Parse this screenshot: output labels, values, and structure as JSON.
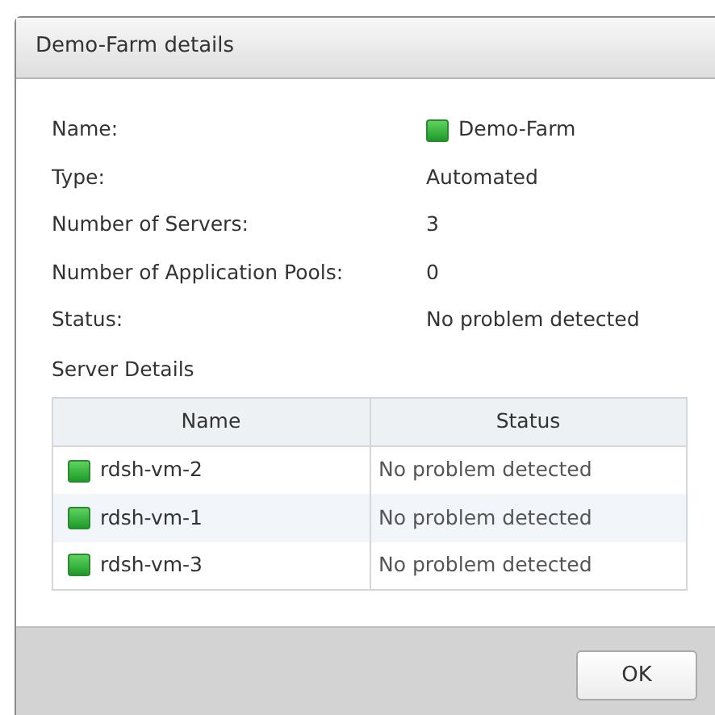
{
  "window": {
    "title": "Demo-Farm details"
  },
  "fields": [
    {
      "label": "Name:",
      "value": "Demo-Farm",
      "kind": "status"
    },
    {
      "label": "Type:",
      "value": "Automated",
      "kind": "text"
    },
    {
      "label": "Number of Servers:",
      "value": "3",
      "kind": "text"
    },
    {
      "label": "Number of Application Pools:",
      "value": "0",
      "kind": "text"
    },
    {
      "label": "Status:",
      "value": "No problem detected",
      "kind": "text"
    }
  ],
  "server_details": {
    "title": "Server Details",
    "columns": [
      "Name",
      "Status"
    ],
    "rows": [
      {
        "name": "rdsh-vm-2",
        "status": "No problem detected"
      },
      {
        "name": "rdsh-vm-1",
        "status": "No problem detected"
      },
      {
        "name": "rdsh-vm-3",
        "status": "No problem detected"
      }
    ]
  },
  "buttons": [
    "OK"
  ]
}
